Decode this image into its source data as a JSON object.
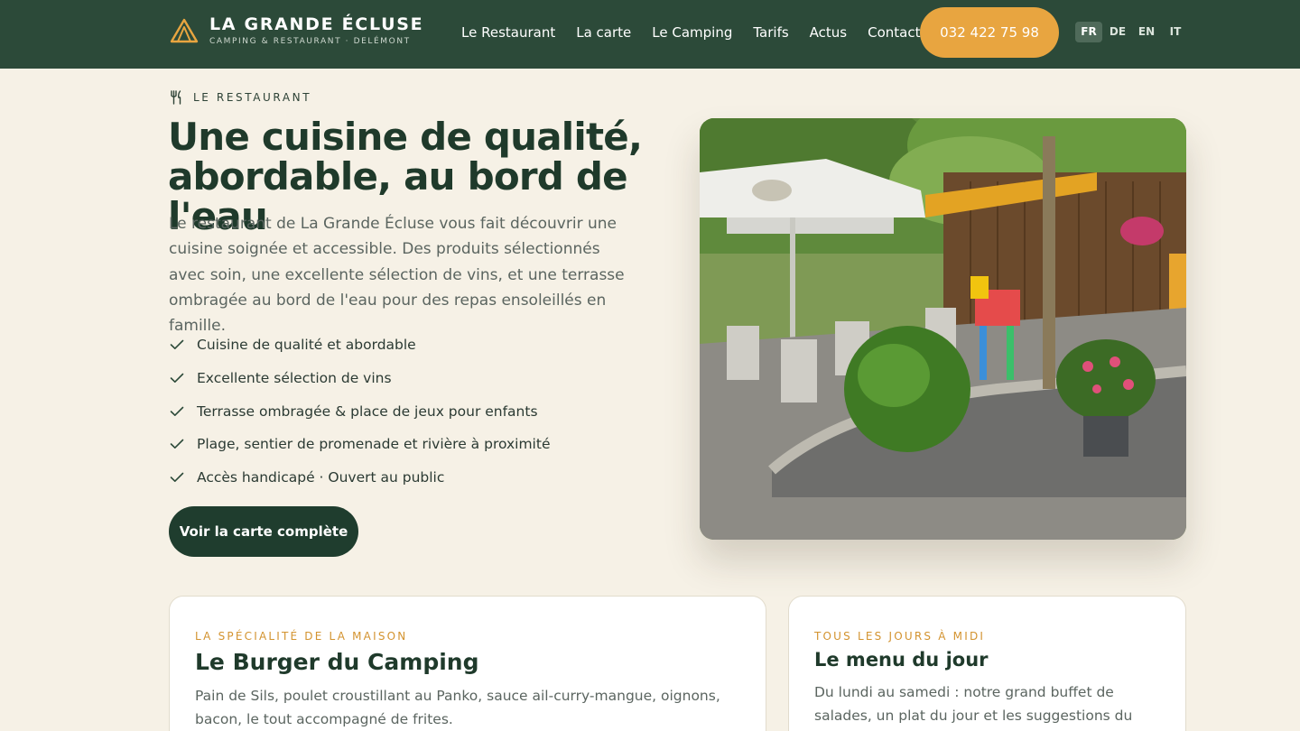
{
  "header": {
    "brand_title": "LA GRANDE ÉCLUSE",
    "brand_subtitle": "CAMPING & RESTAURANT · DELÉMONT",
    "brand_icon": "tent-icon",
    "nav": [
      "Le Restaurant",
      "La carte",
      "Le Camping",
      "Tarifs",
      "Actus",
      "Contact"
    ],
    "phone": "032 422 75 98",
    "languages": [
      "FR",
      "DE",
      "EN",
      "IT"
    ],
    "active_language": "FR"
  },
  "hero": {
    "eyebrow": "LE RESTAURANT",
    "eyebrow_icon": "fork-knife-icon",
    "title_line1": "Une cuisine de qualité,",
    "title_line2": "abordable, au bord de l'eau",
    "description": "Le restaurant de La Grande Écluse vous fait découvrir une cuisine soignée et accessible. Des produits sélectionnés avec soin, une excellente sélection de vins, et une terrasse ombragée au bord de l'eau pour des repas ensoleillés en famille.",
    "features": [
      "Cuisine de qualité et abordable",
      "Excellente sélection de vins",
      "Terrasse ombragée & place de jeux pour enfants",
      "Plage, sentier de promenade et rivière à proximité",
      "Accès handicapé · Ouvert au public"
    ],
    "cta": "Voir la carte complète"
  },
  "cards": [
    {
      "kicker": "LA SPÉCIALITÉ DE LA MAISON",
      "title": "Le Burger du Camping",
      "text": "Pain de Sils, poulet croustillant au Panko, sauce ail-curry-mangue, oignons, bacon, le tout accompagné de frites."
    },
    {
      "kicker": "TOUS LES JOURS À MIDI",
      "title": "Le menu du jour",
      "text": "Du lundi au samedi : notre grand buffet de salades, un plat du jour et les suggestions du chef."
    }
  ],
  "colors": {
    "header_bg": "#2c4a39",
    "accent": "#e8a540",
    "page_bg": "#f6f1e6",
    "dark_green": "#1f3d2e"
  }
}
